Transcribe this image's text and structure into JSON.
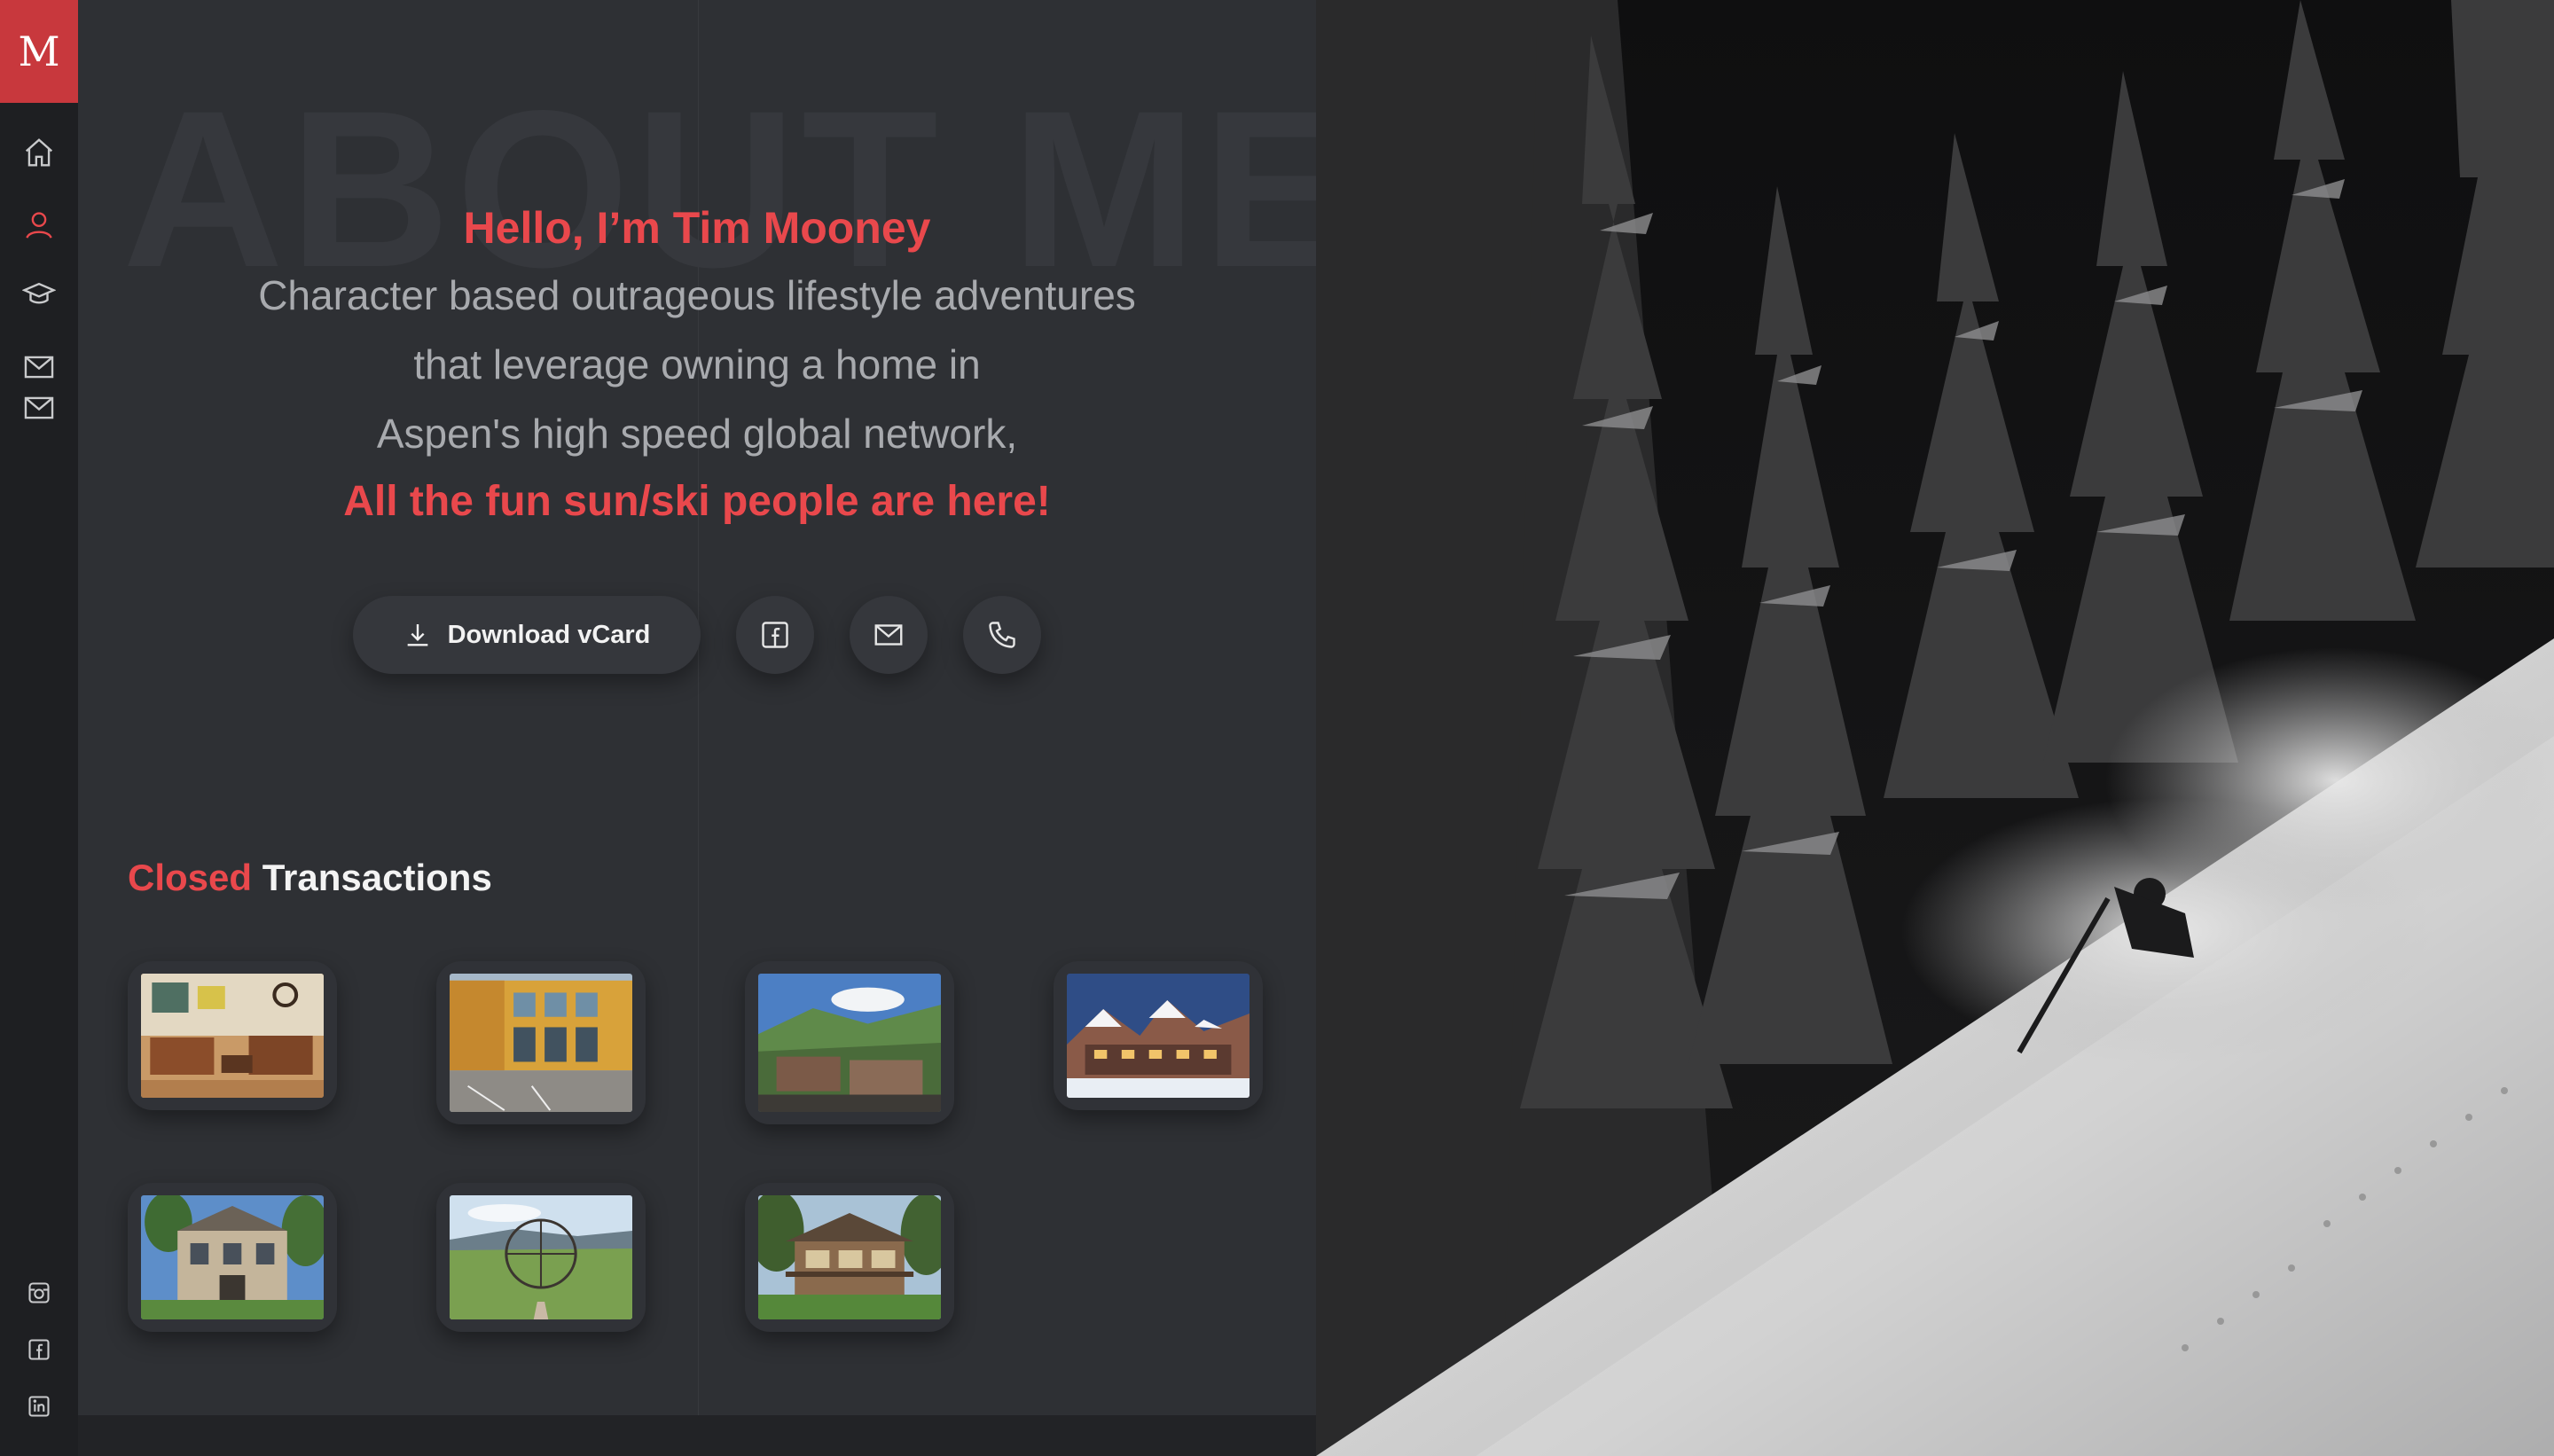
{
  "sidebar": {
    "logo": "M",
    "nav": [
      {
        "name": "home-icon",
        "active": false
      },
      {
        "name": "user-icon",
        "active": true
      },
      {
        "name": "graduation-cap-icon",
        "active": false
      },
      {
        "name": "mail-icon",
        "active": false
      },
      {
        "name": "mail-icon",
        "active": false
      }
    ],
    "social": [
      "instagram-icon",
      "facebook-icon",
      "linkedin-icon"
    ]
  },
  "about": {
    "watermark": "ABOUT ME",
    "hello": "Hello, I’m Tim Mooney",
    "lines": [
      "Character based outrageous lifestyle adventures",
      "that leverage owning a home in",
      "Aspen's high speed global network,"
    ],
    "emphasis": "All the fun sun/ski people are here!",
    "vcard_label": "Download vCard"
  },
  "transactions": {
    "title_accent": "Closed",
    "title_rest": " Transactions",
    "items": [
      "interior-living-room-photo",
      "orange-building-photo",
      "mountain-resort-photo",
      "winter-lodge-photo",
      "stone-house-photo",
      "field-sculpture-photo",
      "timber-home-photo"
    ]
  },
  "colors": {
    "accent": "#e9484c",
    "sidebar": "#1e1f22",
    "panel": "#2e3034",
    "icon": "#c9cacc"
  },
  "hero": {
    "subject": "skier-in-powder-snow-photo"
  }
}
